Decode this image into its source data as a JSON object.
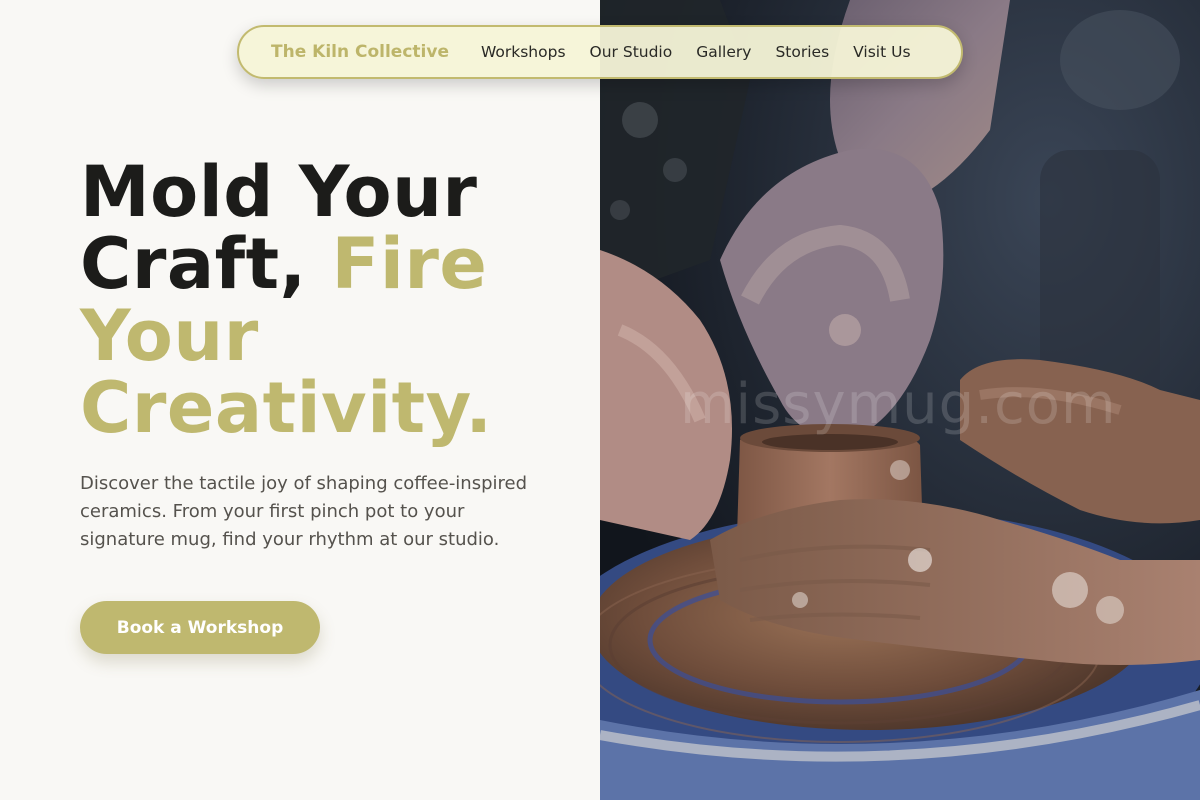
{
  "nav": {
    "brand": "The Kiln Collective",
    "links": [
      {
        "label": "Workshops"
      },
      {
        "label": "Our Studio"
      },
      {
        "label": "Gallery"
      },
      {
        "label": "Stories"
      },
      {
        "label": "Visit Us"
      }
    ]
  },
  "hero": {
    "headline_dark": "Mold Your Craft, ",
    "headline_accent": "Fire Your Creativity.",
    "description": "Discover the tactile joy of shaping coffee-inspired ceramics. From your first pinch pot to your signature mug, find your rhythm at our studio.",
    "cta_label": "Book a Workshop",
    "image_watermark": "missymug.com"
  },
  "colors": {
    "accent": "#bfb86f",
    "page_background": "#f9f8f5",
    "text_dark": "#1c1c1a",
    "text_muted": "#55524d"
  }
}
